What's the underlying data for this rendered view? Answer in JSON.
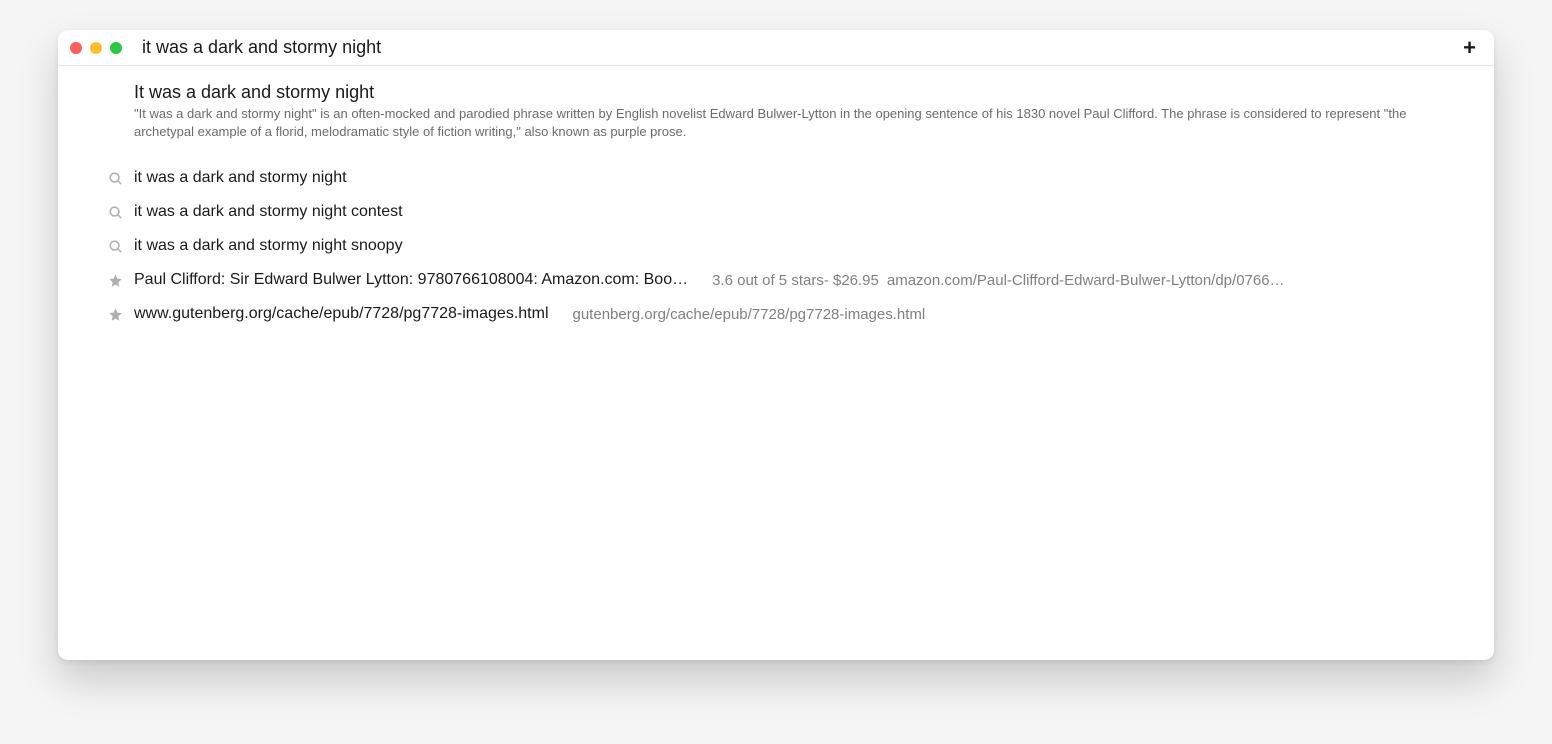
{
  "search": {
    "value": "it was a dark and stormy night"
  },
  "topResult": {
    "title": "It was a dark and stormy night",
    "description": "\"It was a dark and stormy night\" is an often-mocked and parodied phrase written by English novelist Edward Bulwer-Lytton in the opening sentence of his 1830 novel Paul Clifford. The phrase is considered to represent \"the archetypal example of a florid, melodramatic style of fiction writing,\" also known as purple prose."
  },
  "suggestions": [
    {
      "text": "it was a dark and stormy night"
    },
    {
      "text": "it was a dark and stormy night contest"
    },
    {
      "text": "it was a dark and stormy night snoopy"
    }
  ],
  "bookmarks": [
    {
      "title": "Paul Clifford: Sir Edward Bulwer Lytton: 9780766108004: Amazon.com: Boo…",
      "meta": "3.6 out of 5 stars- $26.95",
      "url": "amazon.com/Paul-Clifford-Edward-Bulwer-Lytton/dp/0766…"
    },
    {
      "title": "www.gutenberg.org/cache/epub/7728/pg7728-images.html",
      "meta": "",
      "url": "gutenberg.org/cache/epub/7728/pg7728-images.html"
    }
  ]
}
